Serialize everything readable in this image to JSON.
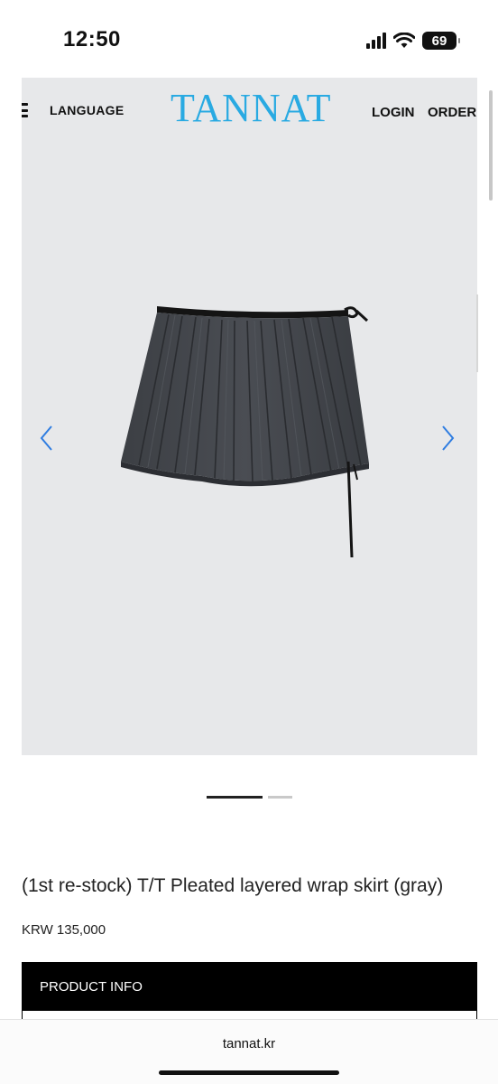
{
  "status_bar": {
    "time": "12:50",
    "battery": "69"
  },
  "header": {
    "language_label": "LANGUAGE",
    "brand": "TANNAT",
    "login_label": "LOGIN",
    "order_label": "ORDER"
  },
  "colors": {
    "brand": "#29aae2",
    "arrow": "#2f7de1",
    "hero_bg": "#e7e8ea"
  },
  "carousel": {
    "current_slide": 1,
    "total_slides": 2
  },
  "product": {
    "title": "(1st re-stock) T/T Pleated layered wrap skirt (gray)",
    "price": "KRW 135,000",
    "info_label": "PRODUCT INFO"
  },
  "browser": {
    "url": "tannat.kr"
  },
  "icons": {
    "menu": "hamburger-menu-icon",
    "prev": "chevron-left-icon",
    "next": "chevron-right-icon",
    "signal": "cellular-signal-icon",
    "wifi": "wifi-icon",
    "battery": "battery-icon"
  }
}
